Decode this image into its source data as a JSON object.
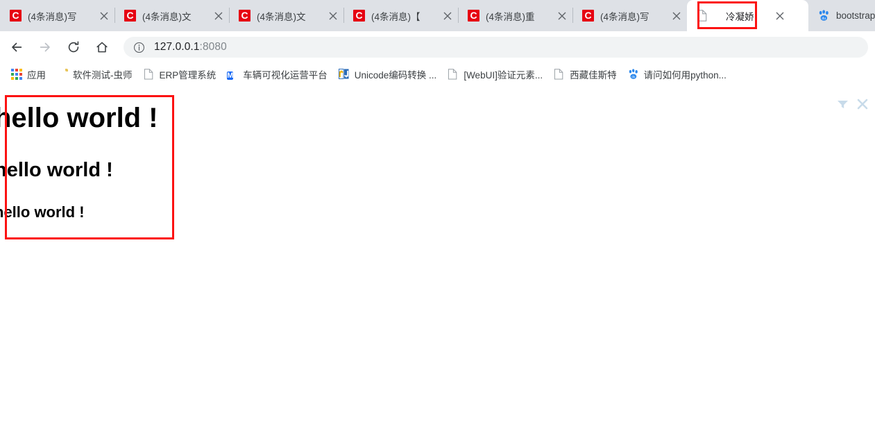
{
  "window": {
    "tabs": [
      {
        "title": "(4条消息)写",
        "favicon": "csdn-icon",
        "active": false
      },
      {
        "title": "(4条消息)文",
        "favicon": "csdn-icon",
        "active": false
      },
      {
        "title": "(4条消息)文",
        "favicon": "csdn-icon",
        "active": false
      },
      {
        "title": "(4条消息)【",
        "favicon": "csdn-icon",
        "active": false
      },
      {
        "title": "(4条消息)重",
        "favicon": "csdn-icon",
        "active": false
      },
      {
        "title": "(4条消息)写",
        "favicon": "csdn-icon",
        "active": false
      },
      {
        "title": "冷凝娇",
        "favicon": "page-icon",
        "active": true
      },
      {
        "title": "bootstrap_",
        "favicon": "baidu-icon",
        "active": false
      }
    ],
    "close_label": "×"
  },
  "toolbar": {
    "back_label": "←",
    "forward_label": "→",
    "reload_label": "⟳",
    "home_label": "⌂",
    "url": "127.0.0.1",
    "url_port": ":8080",
    "url_full": "127.0.0.1:8080",
    "site_info_label": "ⓘ"
  },
  "bookmarks": [
    {
      "label": "应用",
      "icon": "apps-grid-icon"
    },
    {
      "label": "软件测试-虫师",
      "icon": "folder-icon"
    },
    {
      "label": "ERP管理系统",
      "icon": "page-icon"
    },
    {
      "label": "车辆可视化运营平台",
      "icon": "m-square-icon"
    },
    {
      "label": "Unicode编码转换 ...",
      "icon": "unicode-arrows-icon"
    },
    {
      "label": "[WebUI]验证元素...",
      "icon": "page-icon"
    },
    {
      "label": "西藏佳斯特",
      "icon": "page-icon"
    },
    {
      "label": "请问如何用python...",
      "icon": "baidu-paw-icon"
    }
  ],
  "page": {
    "heading_large": "hello world !",
    "heading_medium": "hello world !",
    "heading_small": "hello world !",
    "widgets": {
      "filter_icon": "filter-icon",
      "close_icon": "close-icon"
    }
  },
  "annotations": {
    "tab_highlight_color": "#fc1212",
    "content_highlight_color": "#fc1212"
  }
}
